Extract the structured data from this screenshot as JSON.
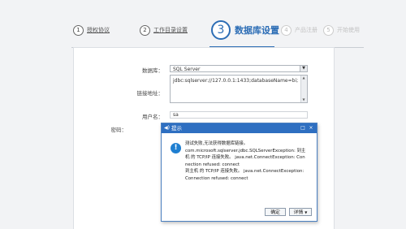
{
  "wizard": {
    "steps": [
      {
        "num": "1",
        "label": "授权协议"
      },
      {
        "num": "2",
        "label": "工作目录设置"
      },
      {
        "num": "3",
        "label": "数据库设置"
      },
      {
        "num": "4",
        "label": "产品注册"
      },
      {
        "num": "5",
        "label": "开始使用"
      }
    ],
    "active_index": 2
  },
  "form": {
    "db_label": "数据库：",
    "db_value": "SQL Server",
    "url_label": "链接地址：",
    "url_value": "jdbc:sqlserver://127.0.0.1:1433;databaseName=bi;",
    "user_label": "用户名：",
    "user_value": "sa",
    "password_label": "密码："
  },
  "dialog": {
    "title": "提示",
    "minimize_icon": "□",
    "close_icon": "×",
    "message_lines": [
      "测试失败,无法获得数据库链接。",
      "com.microsoft.sqlserver.jdbc.SQLServerException: 到主",
      "机 的 TCP/IP 连接失败。 java.net.ConnectException: Con",
      "nection refused: connect",
      "到主机 的 TCP/IP 连接失败。 java.net.ConnectException:",
      "Connection refused: connect"
    ],
    "ok_label": "确定",
    "details_label": "详情",
    "accent": "#2e6fc1"
  }
}
